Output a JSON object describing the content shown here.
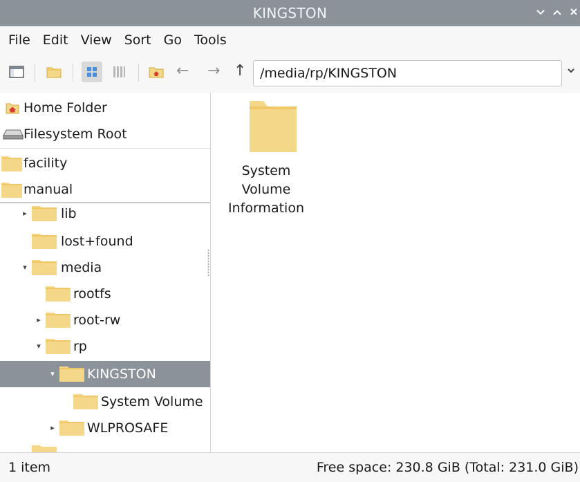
{
  "window": {
    "title": "KINGSTON",
    "controls": [
      "chevron-down-icon",
      "chevron-up-icon",
      "close-icon"
    ]
  },
  "menu": {
    "items": [
      "File",
      "Edit",
      "View",
      "Sort",
      "Go",
      "Tools"
    ]
  },
  "toolbar": {
    "icons": [
      "new-window-icon",
      "new-folder-icon",
      "icon-view-icon",
      "list-view-icon",
      "home-icon",
      "back-arrow-icon",
      "forward-arrow-icon",
      "up-arrow-icon"
    ],
    "back": "←",
    "forward": "→",
    "up": "↑",
    "path": "/media/rp/KINGSTON"
  },
  "sidebar": {
    "places": [
      {
        "label": "Home Folder",
        "icon": "home-icon"
      },
      {
        "label": "Filesystem Root",
        "icon": "drive-icon"
      },
      {
        "label": "facility",
        "icon": "folder-icon"
      },
      {
        "label": "manual",
        "icon": "folder-icon"
      }
    ],
    "tree": [
      {
        "label": "lib",
        "expander": "▸"
      },
      {
        "label": "lost+found",
        "expander": ""
      },
      {
        "label": "media",
        "expander": "▾"
      },
      {
        "label": "rootfs",
        "expander": ""
      },
      {
        "label": "root-rw",
        "expander": "▸"
      },
      {
        "label": "rp",
        "expander": "▾"
      },
      {
        "label": "KINGSTON",
        "expander": "▾",
        "selected": true
      },
      {
        "label": "System Volume",
        "expander": ""
      },
      {
        "label": "WLPROSAFE",
        "expander": "▸"
      }
    ]
  },
  "files": [
    {
      "name": "System Volume Information",
      "lines": [
        "System",
        "Volume",
        "Information"
      ],
      "icon": "folder-icon"
    }
  ],
  "status": {
    "count": "1 item",
    "free": "Free space: 230.8 GiB (Total: 231.0 GiB)"
  },
  "colors": {
    "titlebar": "#8b929a",
    "selection": "#8b929a",
    "folder": "#f5d78a",
    "folder_tab": "#efc865",
    "bar_bg": "#f7f7f7"
  }
}
